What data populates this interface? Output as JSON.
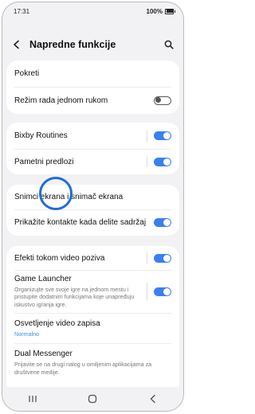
{
  "status_bar": {
    "time": "17:31",
    "battery": "100%"
  },
  "header": {
    "title": "Napredne funkcije"
  },
  "groups": {
    "g1": {
      "pokreti": "Pokreti",
      "one_hand": {
        "label": "Režim rada jednom rukom",
        "toggle": false
      }
    },
    "g2": {
      "bixby": {
        "label": "Bixby Routines",
        "toggle": true
      },
      "suggestions": {
        "label": "Pametni predlozi",
        "toggle": true
      }
    },
    "g3": {
      "screenshots": "Snimci ekrana i snimač ekrana",
      "contacts": {
        "label": "Prikažite kontakte kada delite sadržaj",
        "toggle": true
      }
    },
    "g4": {
      "video_effects": {
        "label": "Efekti tokom video poziva",
        "toggle": true
      },
      "game_launcher": {
        "title": "Game Launcher",
        "desc": "Organizujte sve svoje igre na jednom mestu i pristupite dodatnim funkcijama koje unapređuju iskustvo igranja igre.",
        "toggle": true
      },
      "video_brightness": {
        "title": "Osvetljenje video zapisa",
        "sub": "Normalno"
      },
      "dual_messenger": {
        "title": "Dual Messenger",
        "desc": "Prijavite se na drugi nalog u omiljenim aplikacijama za društvene medije."
      }
    }
  },
  "colors": {
    "accent": "#3b7ff0",
    "link": "#3e8fe5",
    "tap_ring": "#1f6ed8"
  },
  "icons": {
    "back": "back-arrow-icon",
    "search": "search-icon",
    "recents": "recents-icon",
    "home": "home-icon",
    "nav_back": "nav-back-icon"
  }
}
